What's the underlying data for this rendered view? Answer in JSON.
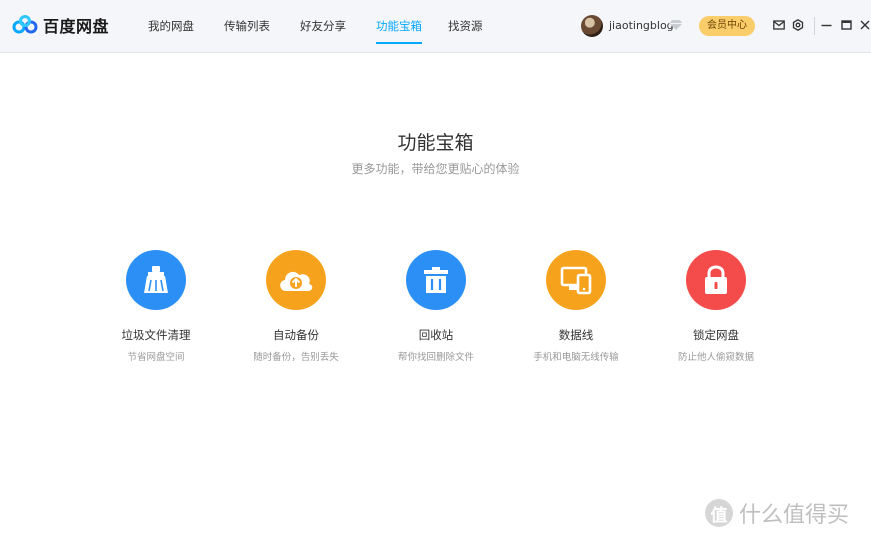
{
  "app": {
    "name": "百度网盘"
  },
  "nav": {
    "items": [
      {
        "label": "我的网盘"
      },
      {
        "label": "传输列表"
      },
      {
        "label": "好友分享"
      },
      {
        "label": "功能宝箱"
      },
      {
        "label": "找资源"
      }
    ],
    "active": "功能宝箱"
  },
  "user": {
    "name": "jiaotingblog"
  },
  "vip_button": "会员中心",
  "main": {
    "title": "功能宝箱",
    "subtitle": "更多功能，带给您更贴心的体验"
  },
  "tools": [
    {
      "name": "垃圾文件清理",
      "desc": "节省网盘空间",
      "icon": "broom-icon",
      "color": "#2b8ff5"
    },
    {
      "name": "自动备份",
      "desc": "随时备份，告别丢失",
      "icon": "cloud-upload-icon",
      "color": "#f7a21d"
    },
    {
      "name": "回收站",
      "desc": "帮你找回删除文件",
      "icon": "trash-icon",
      "color": "#2b8ff5"
    },
    {
      "name": "数据线",
      "desc": "手机和电脑无线传输",
      "icon": "devices-icon",
      "color": "#f7a21d"
    },
    {
      "name": "锁定网盘",
      "desc": "防止他人偷窥数据",
      "icon": "lock-icon",
      "color": "#f44b4b"
    }
  ],
  "colors": {
    "accent": "#06a7ff",
    "vip": "#f9cd6a"
  },
  "watermark": {
    "text": "什么值得买",
    "symbol": "值"
  }
}
